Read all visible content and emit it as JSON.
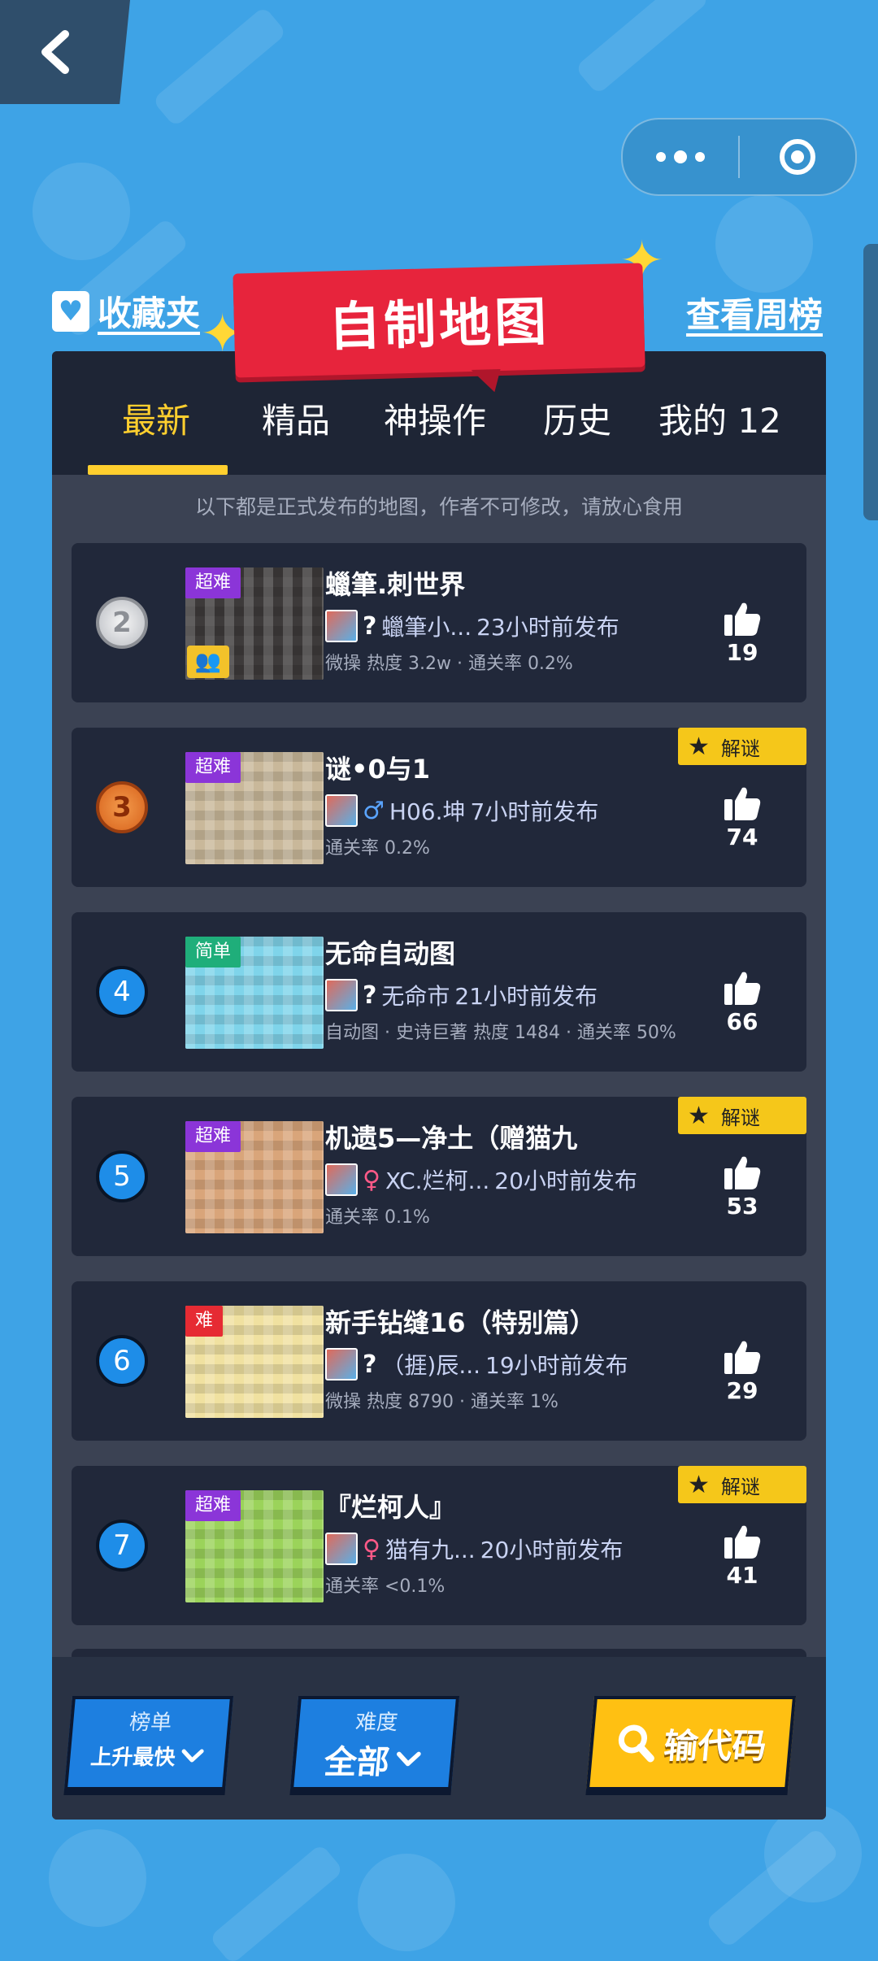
{
  "header": {
    "title": "自制地图",
    "favorites_label": "收藏夹",
    "weekly_label": "查看周榜"
  },
  "tabs": [
    {
      "label": "最新",
      "active": true
    },
    {
      "label": "精品",
      "active": false
    },
    {
      "label": "神操作",
      "active": false
    },
    {
      "label": "历史",
      "active": false
    },
    {
      "label": "我的 12",
      "active": false
    }
  ],
  "notice": "以下都是正式发布的地图，作者不可修改，请放心食用",
  "maps": [
    {
      "rank": "2",
      "rank_style": "silver",
      "difficulty": "超难",
      "difficulty_color": "#8b35d8",
      "title": "蠟筆.刺世界",
      "gender": "?",
      "author": "蠟筆小...",
      "time": "23小时前发布",
      "meta": "微操 热度 3.2w · 通关率 0.2%",
      "likes": "19",
      "puzzle": false,
      "has_badge": true,
      "thumb_bg": "#3d3a3a"
    },
    {
      "rank": "3",
      "rank_style": "bronze",
      "difficulty": "超难",
      "difficulty_color": "#8b35d8",
      "title": "谜•0与1",
      "gender": "♂",
      "author": "H06.坤",
      "time": "7小时前发布",
      "meta": "通关率 0.2%",
      "likes": "74",
      "puzzle": true,
      "has_badge": false,
      "thumb_bg": "#c9b89a"
    },
    {
      "rank": "4",
      "rank_style": "blue",
      "difficulty": "简单",
      "difficulty_color": "#1fae7a",
      "title": "无命自动图",
      "gender": "?",
      "author": "无命市",
      "time": "21小时前发布",
      "meta": "自动图 · 史诗巨著 热度 1484 · 通关率 50%",
      "likes": "66",
      "puzzle": false,
      "has_badge": false,
      "thumb_bg": "#7fd4ea"
    },
    {
      "rank": "5",
      "rank_style": "blue",
      "difficulty": "超难",
      "difficulty_color": "#8b35d8",
      "title": "机遗5—净土（赠猫九",
      "gender": "♀",
      "author": "XC.烂柯...",
      "time": "20小时前发布",
      "meta": "通关率 0.1%",
      "likes": "53",
      "puzzle": true,
      "has_badge": false,
      "thumb_bg": "#d9a57a"
    },
    {
      "rank": "6",
      "rank_style": "blue",
      "difficulty": "难",
      "difficulty_color": "#e62b33",
      "title": "新手钻缝16（特别篇）",
      "gender": "?",
      "author": "（捱)辰...",
      "time": "19小时前发布",
      "meta": "微操 热度 8790 · 通关率 1%",
      "likes": "29",
      "puzzle": false,
      "has_badge": false,
      "thumb_bg": "#f0e1a0"
    },
    {
      "rank": "7",
      "rank_style": "blue",
      "difficulty": "超难",
      "difficulty_color": "#8b35d8",
      "title": "『烂柯人』",
      "gender": "♀",
      "author": "猫有九...",
      "time": "20小时前发布",
      "meta": "通关率 <0.1%",
      "likes": "41",
      "puzzle": true,
      "has_badge": false,
      "thumb_bg": "#9bd35a"
    }
  ],
  "puzzle_label": "解谜",
  "bottom": {
    "ranking_label": "榜单",
    "ranking_value": "上升最快",
    "difficulty_label": "难度",
    "difficulty_value": "全部",
    "code_label": "输代码"
  },
  "colors": {
    "background": "#3ea3e6",
    "panel": "#3b4253",
    "card": "#21283a",
    "accent_yellow": "#ffcf2e",
    "banner_red": "#e7243c"
  }
}
